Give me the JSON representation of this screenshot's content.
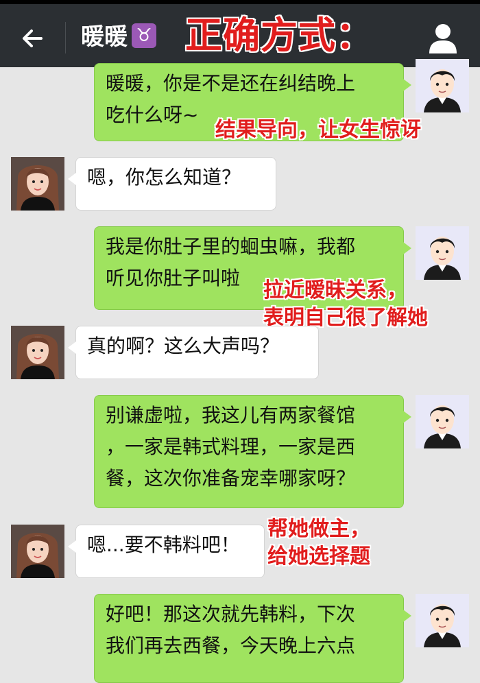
{
  "header": {
    "contact_name": "暖暖",
    "zodiac_symbol": "♉",
    "back_icon": "arrow-left-icon",
    "profile_icon": "user-icon",
    "overlay_title": "正确方式："
  },
  "messages": [
    {
      "from": "me",
      "lines": [
        "暖暖，你是不是还在纠结晚上",
        "吃什么呀~"
      ]
    },
    {
      "from": "her",
      "lines": [
        "嗯，你怎么知道？"
      ]
    },
    {
      "from": "me",
      "lines": [
        "我是你肚子里的蛔虫嘛，我都",
        "听见你肚子叫啦"
      ]
    },
    {
      "from": "her",
      "lines": [
        "真的啊？这么大声吗？"
      ]
    },
    {
      "from": "me",
      "lines": [
        "别谦虚啦，我这儿有两家餐馆",
        "，一家是韩式料理，一家是西",
        "餐，这次你准备宠幸哪家呀？"
      ]
    },
    {
      "from": "her",
      "lines": [
        "嗯...要不韩料吧！"
      ]
    },
    {
      "from": "me",
      "lines": [
        "好吧！那这次就先韩料，下次",
        "我们再去西餐，今天晚上六点"
      ]
    }
  ],
  "annotations": [
    [
      "结果导向，让女生惊讶"
    ],
    [
      "拉近暧昧关系，",
      "表明自己很了解她"
    ],
    [
      "帮她做主，",
      "给她选择题"
    ]
  ],
  "colors": {
    "header_bg": "#2b2f33",
    "my_bubble": "#9fe35f",
    "her_bubble": "#ffffff",
    "annotation": "#e11d1d",
    "chat_bg": "#e6e6e6"
  }
}
